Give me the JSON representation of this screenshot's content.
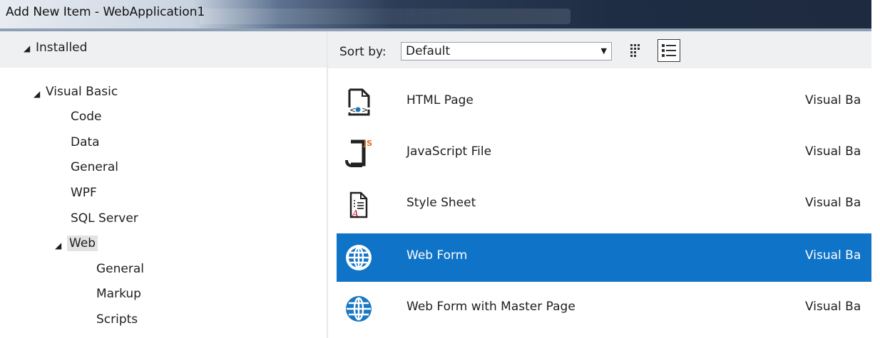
{
  "window": {
    "title": "Add New Item - WebApplication1"
  },
  "left_pane": {
    "installed_label": "Installed",
    "tree": [
      {
        "label": "Visual Basic",
        "level": 0,
        "expanded": true
      },
      {
        "label": "Code",
        "level": 1
      },
      {
        "label": "Data",
        "level": 1
      },
      {
        "label": "General",
        "level": 1
      },
      {
        "label": "WPF",
        "level": 1
      },
      {
        "label": "SQL Server",
        "level": 1
      },
      {
        "label": "Web",
        "level": 1,
        "expanded": true,
        "selected": true
      },
      {
        "label": "General",
        "level": 2
      },
      {
        "label": "Markup",
        "level": 2
      },
      {
        "label": "Scripts",
        "level": 2
      }
    ]
  },
  "toolbar": {
    "sort_label": "Sort by:",
    "sort_value": "Default"
  },
  "items": [
    {
      "name": "HTML Page",
      "language": "Visual Ba",
      "icon": "html-page-icon"
    },
    {
      "name": "JavaScript File",
      "language": "Visual Ba",
      "icon": "javascript-file-icon"
    },
    {
      "name": "Style Sheet",
      "language": "Visual Ba",
      "icon": "style-sheet-icon"
    },
    {
      "name": "Web Form",
      "language": "Visual Ba",
      "icon": "globe-icon",
      "selected": true
    },
    {
      "name": "Web Form with Master Page",
      "language": "Visual Ba",
      "icon": "globe-icon"
    }
  ],
  "colors": {
    "selection": "#0f73c7",
    "pane_header": "#eef0f2"
  }
}
